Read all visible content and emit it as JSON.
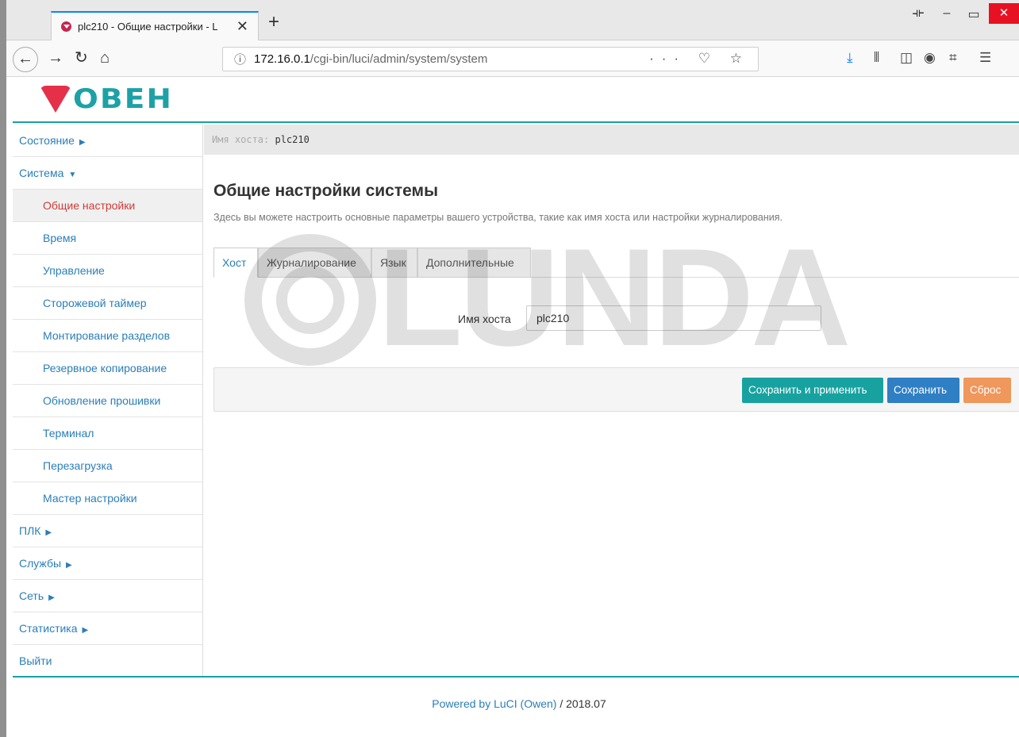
{
  "browser": {
    "tab_title": "plc210 - Общие настройки - L",
    "url_host": "172.16.0.1",
    "url_path": "/cgi-bin/luci/admin/system/system"
  },
  "logo": {
    "text": "ОВЕН"
  },
  "sidebar": {
    "items": [
      {
        "label": "Состояние",
        "level": 0
      },
      {
        "label": "Система",
        "level": 0
      },
      {
        "label": "Общие настройки",
        "level": 1,
        "active": true
      },
      {
        "label": "Время",
        "level": 1
      },
      {
        "label": "Управление",
        "level": 1
      },
      {
        "label": "Сторожевой таймер",
        "level": 1
      },
      {
        "label": "Монтирование разделов",
        "level": 1
      },
      {
        "label": "Резервное копирование",
        "level": 1
      },
      {
        "label": "Обновление прошивки",
        "level": 1
      },
      {
        "label": "Терминал",
        "level": 1
      },
      {
        "label": "Перезагрузка",
        "level": 1
      },
      {
        "label": "Мастер настройки",
        "level": 1
      },
      {
        "label": "ПЛК",
        "level": 0
      },
      {
        "label": "Службы",
        "level": 0
      },
      {
        "label": "Сеть",
        "level": 0
      },
      {
        "label": "Статистика",
        "level": 0
      },
      {
        "label": "Выйти",
        "level": 0
      }
    ]
  },
  "main": {
    "hostname_label": "Имя хоста:",
    "hostname_value": "plc210",
    "title": "Общие настройки системы",
    "description": "Здесь вы можете настроить основные параметры вашего устройства, такие как имя хоста или настройки журналирования.",
    "tabs": [
      "Хост",
      "Журналирование",
      "Язык",
      "Дополнительные"
    ],
    "field_label": "Имя хоста",
    "field_value": "plc210",
    "buttons": {
      "apply": "Сохранить и применить",
      "save": "Сохранить",
      "reset": "Сброс"
    }
  },
  "footer": {
    "powered_by": "Powered by LuCI (Owen)",
    "version": " / 2018.07"
  },
  "watermark": "LUNDA",
  "colors": {
    "accent": "#17a2a0",
    "link": "#2a7eb8",
    "active": "#d13a34",
    "save": "#2f7fc5",
    "reset": "#f0975b"
  }
}
